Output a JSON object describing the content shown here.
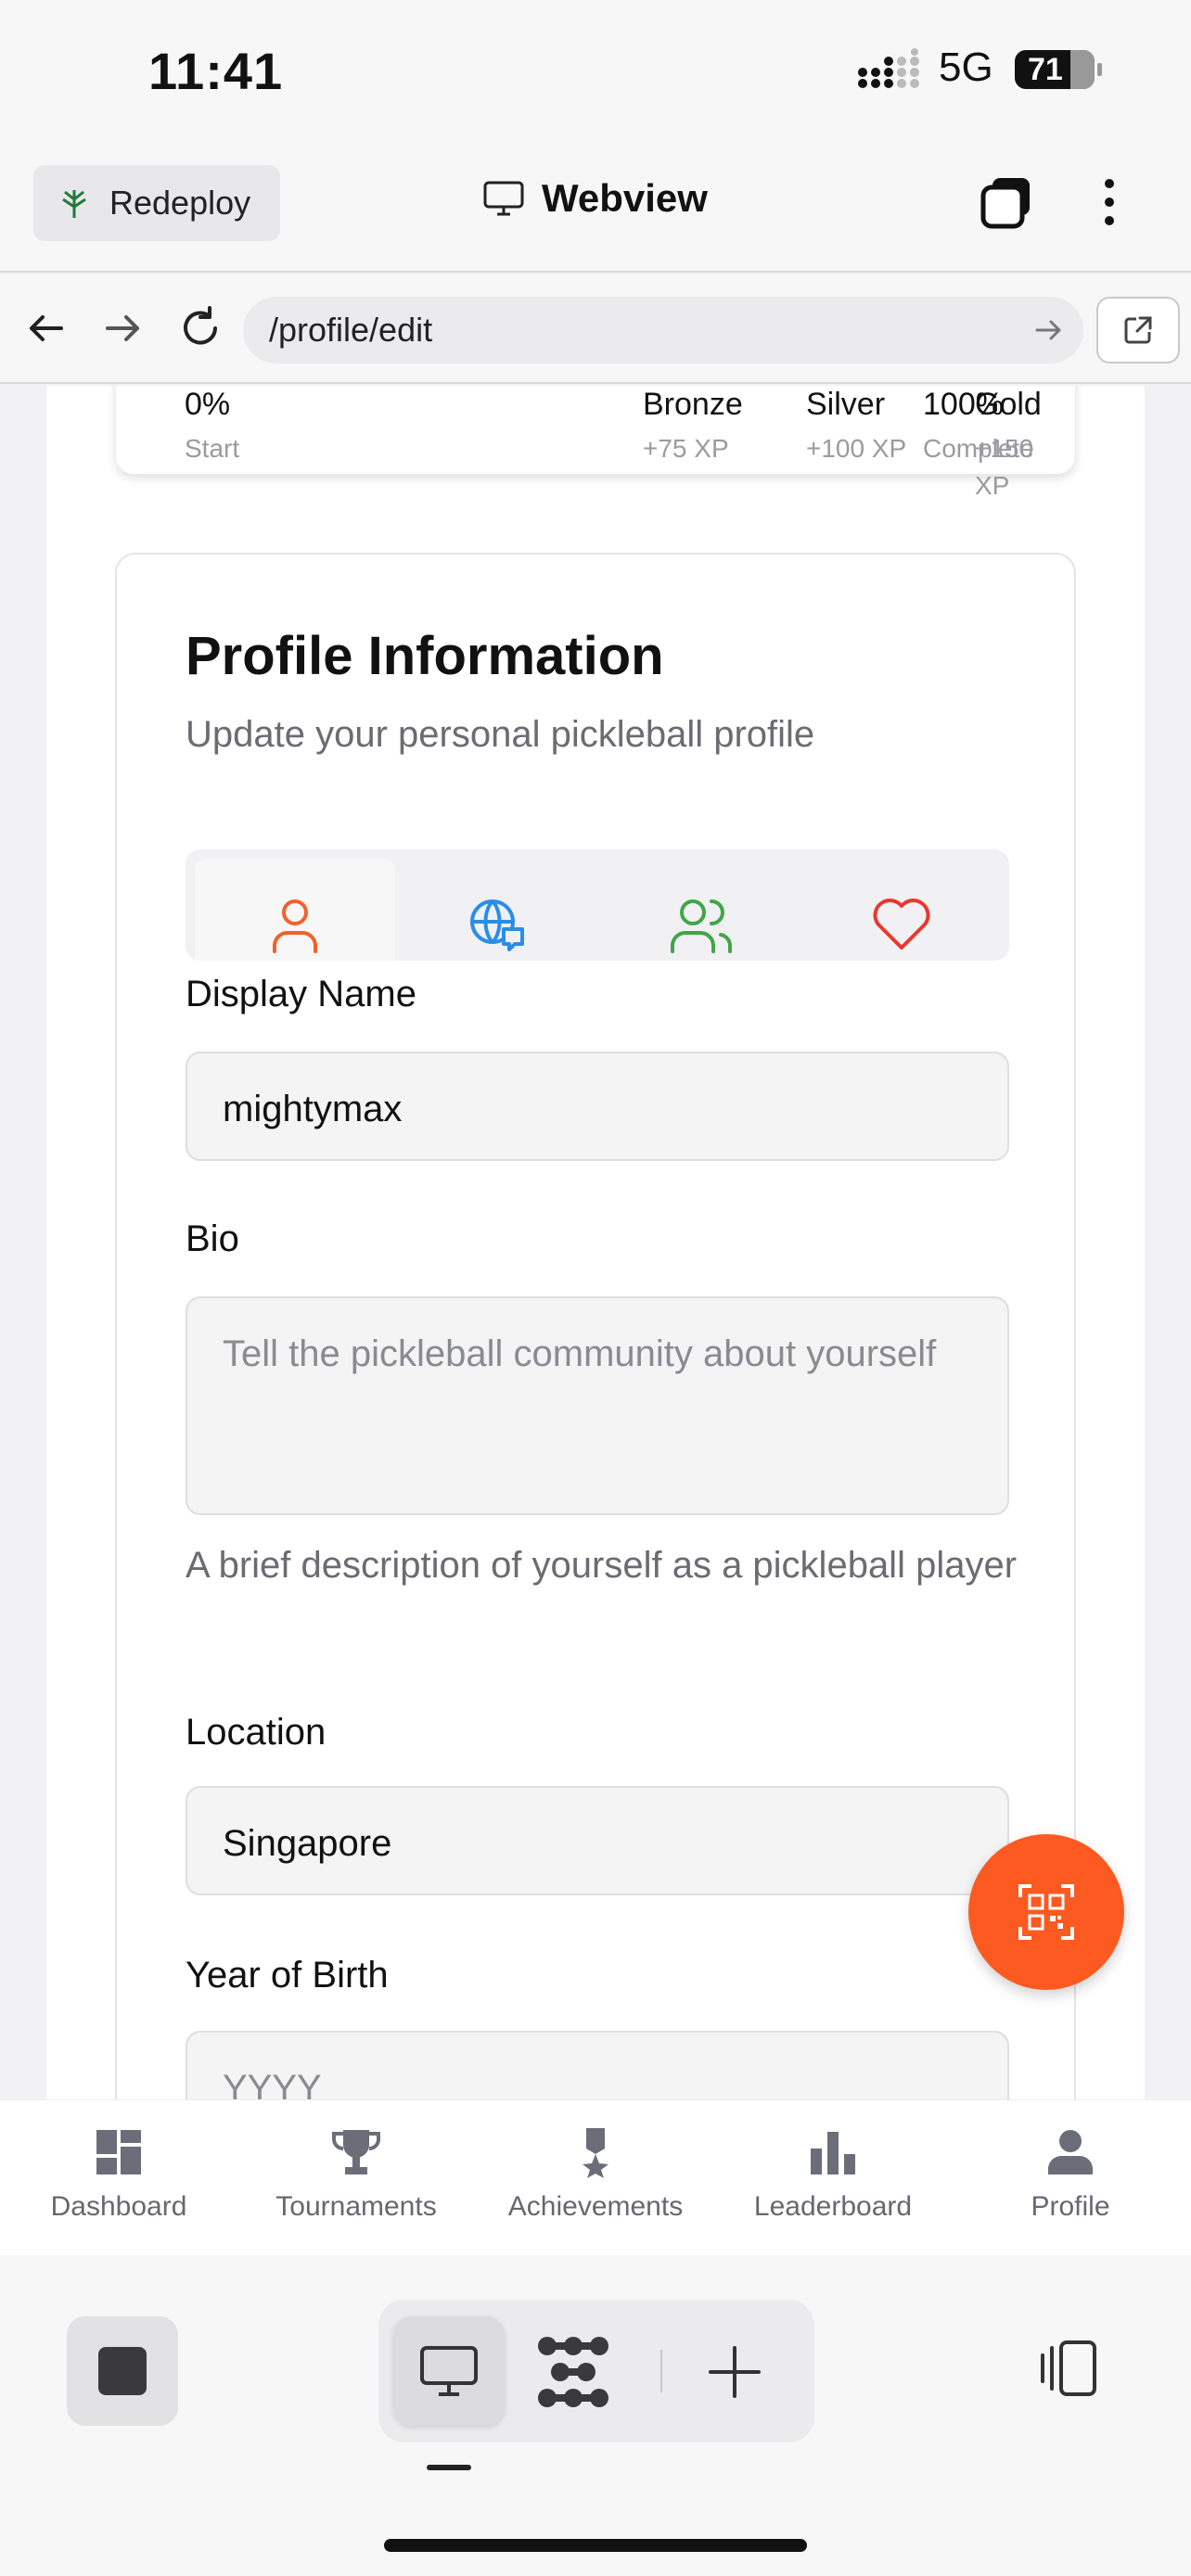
{
  "status": {
    "time": "11:41",
    "network": "5G",
    "battery": "71"
  },
  "header": {
    "redeploy_label": "Redeploy",
    "title": "Webview"
  },
  "url_bar": {
    "url": "/profile/edit"
  },
  "progress": {
    "milestones": [
      {
        "title": "0%",
        "sub": "Start"
      },
      {
        "title": "Bronze",
        "sub": "+75 XP"
      },
      {
        "title": "Silver",
        "sub": "+100 XP"
      },
      {
        "title": "100%",
        "sub": "Complete"
      },
      {
        "title": "Gold",
        "sub": "+150 XP"
      }
    ]
  },
  "profile": {
    "title": "Profile Information",
    "subtitle": "Update your personal pickleball profile",
    "tabs": [
      {
        "icon": "user-icon",
        "color": "#f0622b"
      },
      {
        "icon": "globe-chat-icon",
        "color": "#2a8ee8"
      },
      {
        "icon": "users-icon",
        "color": "#3fa64a"
      },
      {
        "icon": "heart-icon",
        "color": "#e8372f"
      }
    ],
    "display_name": {
      "label": "Display Name",
      "value": "mightymax"
    },
    "bio": {
      "label": "Bio",
      "placeholder": "Tell the pickleball community about yourself",
      "help": "A brief description of yourself as a pickleball player"
    },
    "location": {
      "label": "Location",
      "value": "Singapore"
    },
    "year_of_birth": {
      "label": "Year of Birth",
      "placeholder": "YYYY"
    }
  },
  "fab": {
    "icon": "qr-scan-icon",
    "color": "#fc5a20"
  },
  "app_nav": [
    {
      "label": "Dashboard",
      "icon": "dashboard-icon"
    },
    {
      "label": "Tournaments",
      "icon": "trophy-icon"
    },
    {
      "label": "Achievements",
      "icon": "medal-icon"
    },
    {
      "label": "Leaderboard",
      "icon": "bar-chart-icon"
    },
    {
      "label": "Profile",
      "icon": "person-icon"
    }
  ]
}
